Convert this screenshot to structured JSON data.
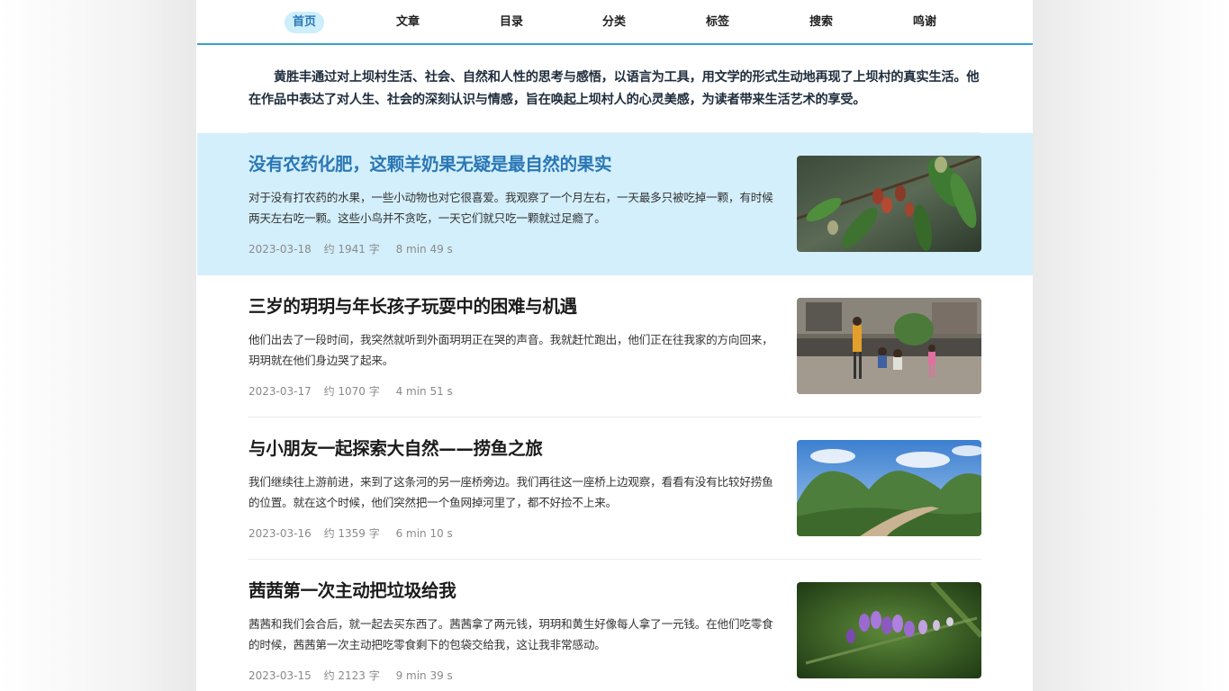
{
  "nav": {
    "items": [
      {
        "label": "首页",
        "active": true
      },
      {
        "label": "文章",
        "active": false
      },
      {
        "label": "目录",
        "active": false
      },
      {
        "label": "分类",
        "active": false
      },
      {
        "label": "标签",
        "active": false
      },
      {
        "label": "搜索",
        "active": false
      },
      {
        "label": "鸣谢",
        "active": false
      }
    ]
  },
  "intro": {
    "text": "黄胜丰通过对上坝村生活、社会、自然和人性的思考与感悟，以语言为工具，用文学的形式生动地再现了上坝村的真实生活。他在作品中表达了对人生、社会的深刻认识与情感，旨在唤起上坝村人的心灵美感，为读者带来生活艺术的享受。"
  },
  "posts": [
    {
      "title": "没有农药化肥，这颗羊奶果无疑是最自然的果实",
      "excerpt": "对于没有打农药的水果，一些小动物也对它很喜爱。我观察了一个月左右，一天最多只被吃掉一颗，有时候两天左右吃一颗。这些小鸟并不贪吃，一天它们就只吃一颗就过足瘾了。",
      "date": "2023-03-18",
      "words": "约 1941  字",
      "read_time": "8 min 49 s",
      "image": "oleaster-berries-photo"
    },
    {
      "title": "三岁的玥玥与年长孩子玩耍中的困难与机遇",
      "excerpt": "他们出去了一段时间，我突然就听到外面玥玥正在哭的声音。我就赶忙跑出，他们正在往我家的方向回来，玥玥就在他们身边哭了起来。",
      "date": "2023-03-17",
      "words": "约 1070  字",
      "read_time": "4 min 51 s",
      "image": "children-playing-photo"
    },
    {
      "title": "与小朋友一起探索大自然——捞鱼之旅",
      "excerpt": "我们继续往上游前进，来到了这条河的另一座桥旁边。我们再往这一座桥上边观察，看看有没有比较好捞鱼的位置。就在这个时候，他们突然把一个鱼网掉河里了，都不好捡不上来。",
      "date": "2023-03-16",
      "words": "约 1359  字",
      "read_time": "6 min 10 s",
      "image": "karst-mountain-road-photo"
    },
    {
      "title": "茜茜第一次主动把垃圾给我",
      "excerpt": "茜茜和我们会合后，就一起去买东西了。茜茜拿了两元钱，玥玥和黄生好像每人拿了一元钱。在他们吃零食的时候，茜茜第一次主动把吃零食剩下的包袋交给我，这让我非常感动。",
      "date": "2023-03-15",
      "words": "约 2123  字",
      "read_time": "9 min 39 s",
      "image": "purple-flower-photo"
    }
  ],
  "colors": {
    "accent": "#2b77b5",
    "nav_border": "#3aa0c8",
    "highlight_bg": "#d3effb",
    "active_nav_bg": "#cdeefb"
  }
}
